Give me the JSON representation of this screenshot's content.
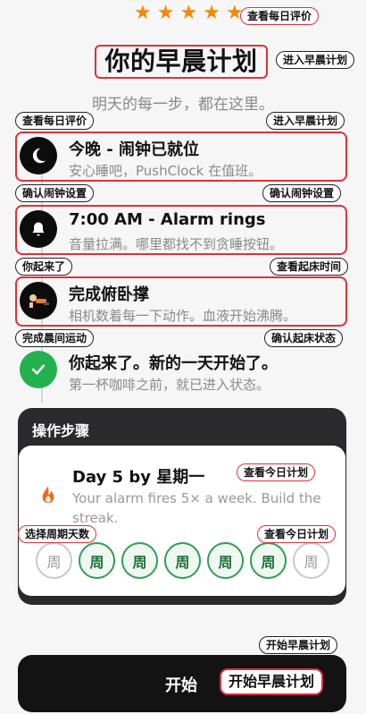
{
  "header": {
    "stars": [
      "★",
      "★",
      "★",
      "★",
      "★"
    ],
    "rating_tag": "查看每日评价",
    "title": "你的早晨计划",
    "title_tag": "进入早晨计划",
    "subtitle": "明天的每一步，都在这里。"
  },
  "timeline": {
    "tags_row1": {
      "left": "查看每日评价",
      "right": "进入早晨计划"
    },
    "tags_row2": {
      "left": "确认闹钟设置",
      "right": "确认闹钟设置"
    },
    "tags_row3": {
      "left": "你起来了",
      "right": "查看起床时间"
    },
    "tags_row4": {
      "left": "完成晨间运动",
      "right": "确认起床状态"
    },
    "steps": [
      {
        "icon": "moon-icon",
        "glyph": "☾",
        "title": "今晚 - 闹钟已就位",
        "desc": "安心睡吧，PushClock 在值班。"
      },
      {
        "icon": "bell-icon",
        "glyph": "🔔",
        "title": "7:00 AM - Alarm rings",
        "desc": "音量拉满。哪里都找不到贪睡按钮。"
      },
      {
        "icon": "pushup-icon",
        "glyph": "🏋",
        "title": "完成俯卧撑",
        "desc": "相机数着每一下动作。血液开始沸腾。"
      },
      {
        "icon": "check-icon",
        "glyph": "✓",
        "title": "你起来了。新的一天开始了。",
        "desc": "第一杯咖啡之前，就已进入状态。"
      }
    ]
  },
  "panel": {
    "title": "操作步骤",
    "card": {
      "title": "Day 5 by 星期一",
      "title_tag": "查看今日计划",
      "desc": "Your alarm fires 5× a week. Build the streak.",
      "days_tag_left": "选择周期天数",
      "days_tag_right": "查看今日计划",
      "days": [
        {
          "label": "周",
          "active": false
        },
        {
          "label": "周",
          "active": true
        },
        {
          "label": "周",
          "active": true
        },
        {
          "label": "周",
          "active": true
        },
        {
          "label": "周",
          "active": true
        },
        {
          "label": "周",
          "active": true
        },
        {
          "label": "周",
          "active": false
        }
      ]
    }
  },
  "cta": {
    "tag_above": "开始早晨计划",
    "label": "开始",
    "button_tag": "开始早晨计划"
  },
  "colors": {
    "accent_red": "#e0303a",
    "star": "#f08a0c",
    "green": "#23b14d"
  }
}
